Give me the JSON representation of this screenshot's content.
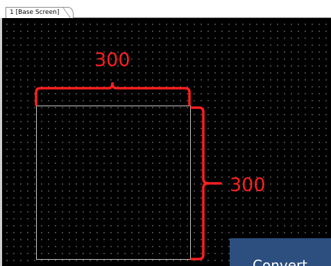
{
  "tab": {
    "label": "1 [Base Screen]"
  },
  "dimensions": {
    "width_label": "300",
    "height_label": "300"
  },
  "notice": {
    "text": "Convert"
  },
  "colors": {
    "background": "#000000",
    "grid_dot": "#6a6a6a",
    "annotation": "#ff1f1f",
    "rectangle_outline": "#cfcfcf",
    "notice_bg": "#2c4f80"
  }
}
